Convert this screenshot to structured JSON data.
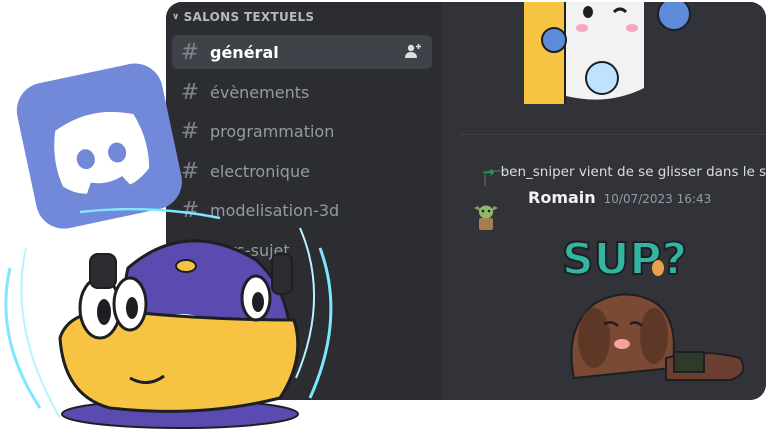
{
  "sidebar": {
    "category": "SALONS TEXTUELS",
    "channels": [
      {
        "name": "général",
        "active": true
      },
      {
        "name": "évènements"
      },
      {
        "name": "programmation"
      },
      {
        "name": "electronique"
      },
      {
        "name": "modelisation-3d"
      },
      {
        "name": "hors-sujet"
      }
    ]
  },
  "chat": {
    "join_text": "ben_sniper vient de se glisser dans le serveur.",
    "author": "Romain",
    "timestamp": "10/07/2023 16:43",
    "sticker_text": "SUP?"
  },
  "colors": {
    "blurple": "#7289da",
    "sidebar_bg": "#2b2d31",
    "chat_bg": "#313338",
    "active_bg": "#404249",
    "join_arrow": "#23a559",
    "sticker_teal": "#33b5a4"
  },
  "icons": [
    "chevron-down-icon",
    "hash-icon",
    "add-user-icon",
    "arrow-right-icon"
  ]
}
